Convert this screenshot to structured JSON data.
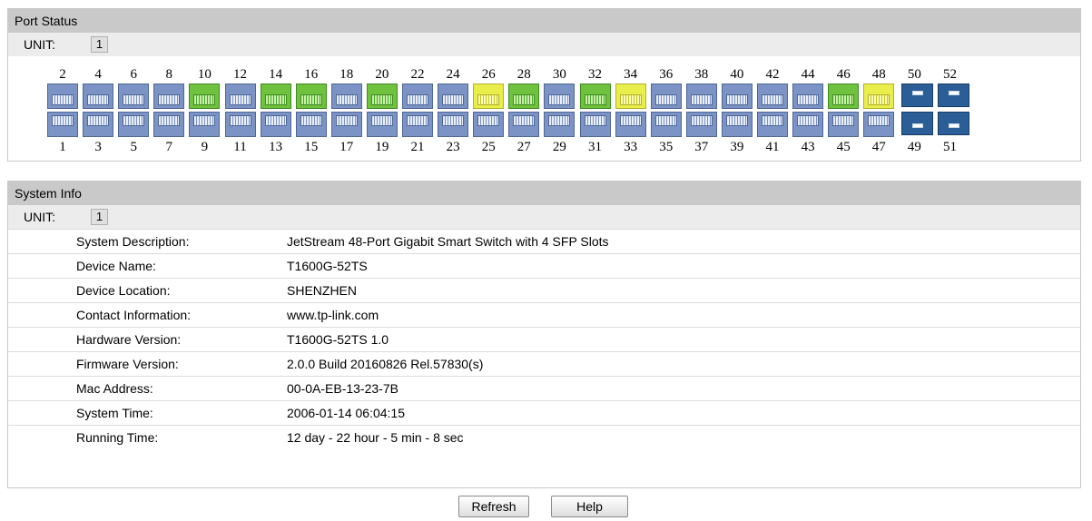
{
  "port_status": {
    "title": "Port Status",
    "unit_label": "UNIT:",
    "unit_value": "1",
    "top_numbers": [
      "2",
      "4",
      "6",
      "8",
      "10",
      "12",
      "14",
      "16",
      "18",
      "20",
      "22",
      "24",
      "26",
      "28",
      "30",
      "32",
      "34",
      "36",
      "38",
      "40",
      "42",
      "44",
      "46",
      "48",
      "50",
      "52"
    ],
    "bottom_numbers": [
      "1",
      "3",
      "5",
      "7",
      "9",
      "11",
      "13",
      "15",
      "17",
      "19",
      "21",
      "23",
      "25",
      "27",
      "29",
      "31",
      "33",
      "35",
      "37",
      "39",
      "41",
      "43",
      "45",
      "47",
      "49",
      "51"
    ],
    "top_states": [
      "down",
      "down",
      "down",
      "down",
      "green",
      "down",
      "green",
      "green",
      "down",
      "green",
      "down",
      "down",
      "yellow",
      "green",
      "down",
      "green",
      "yellow",
      "down",
      "down",
      "down",
      "down",
      "down",
      "green",
      "yellow",
      "sfp",
      "sfp"
    ],
    "bottom_states": [
      "down",
      "down",
      "down",
      "down",
      "down",
      "down",
      "down",
      "down",
      "down",
      "down",
      "down",
      "down",
      "down",
      "down",
      "down",
      "down",
      "down",
      "down",
      "down",
      "down",
      "down",
      "down",
      "down",
      "down",
      "sfp",
      "sfp"
    ],
    "colors": {
      "link_green": "#6ec23e",
      "link_yellow": "#e9ee4a",
      "down": "#7b94c5",
      "sfp": "#2b5e97"
    }
  },
  "system_info": {
    "title": "System Info",
    "unit_label": "UNIT:",
    "unit_value": "1",
    "rows": [
      {
        "label": "System Description:",
        "value": "JetStream 48-Port Gigabit Smart Switch with 4 SFP Slots"
      },
      {
        "label": "Device Name:",
        "value": "T1600G-52TS"
      },
      {
        "label": "Device Location:",
        "value": "SHENZHEN"
      },
      {
        "label": "Contact Information:",
        "value": "www.tp-link.com"
      },
      {
        "label": "Hardware Version:",
        "value": "T1600G-52TS 1.0"
      },
      {
        "label": "Firmware Version:",
        "value": "2.0.0 Build 20160826 Rel.57830(s)"
      },
      {
        "label": "Mac Address:",
        "value": "00-0A-EB-13-23-7B"
      },
      {
        "label": "System Time:",
        "value": "2006-01-14 06:04:15"
      },
      {
        "label": "Running Time:",
        "value": "12 day - 22 hour - 5 min - 8 sec"
      }
    ]
  },
  "buttons": {
    "refresh": "Refresh",
    "help": "Help"
  }
}
